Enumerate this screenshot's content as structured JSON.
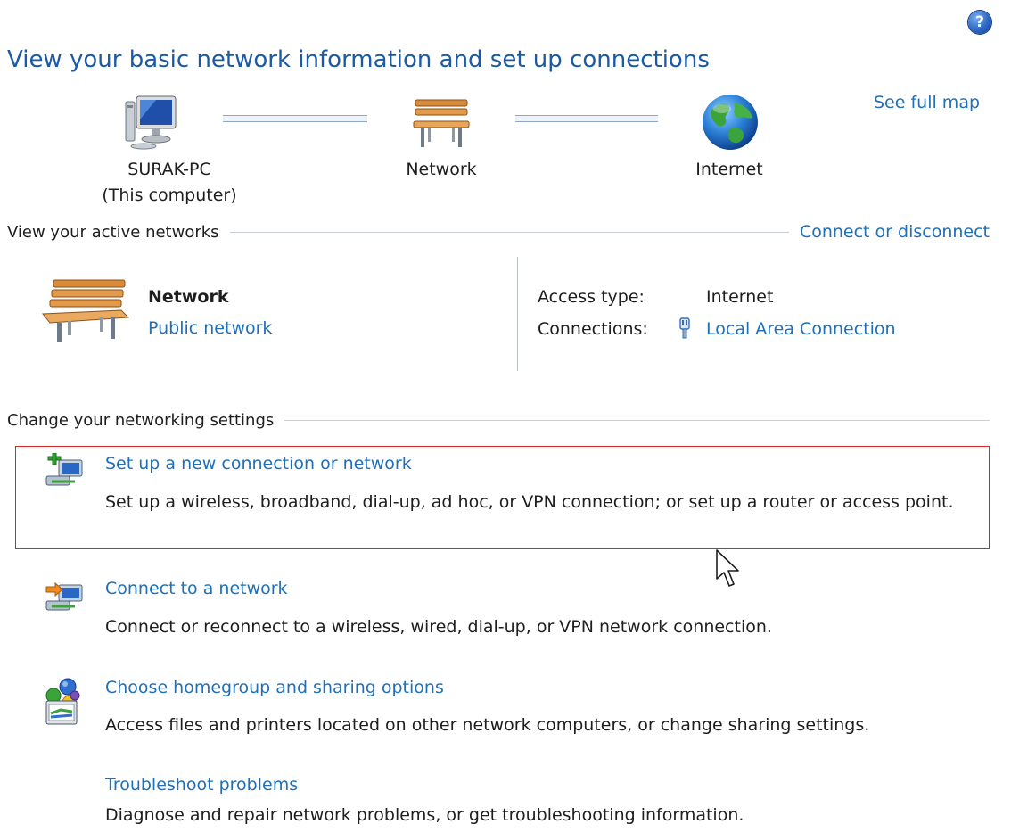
{
  "header": {
    "title": "View your basic network information and set up connections",
    "help_icon": "help-icon",
    "help_glyph": "?"
  },
  "network_map": {
    "computer": {
      "icon": "computer-icon",
      "label_line1": "SURAK-PC",
      "label_line2": "(This computer)"
    },
    "network": {
      "icon": "bench-icon",
      "label": "Network"
    },
    "internet": {
      "icon": "globe-icon",
      "label": "Internet"
    },
    "see_full_map": "See full map"
  },
  "active_networks": {
    "title": "View your active networks",
    "connect_link": "Connect or disconnect",
    "network_name": "Network",
    "network_category": "Public network",
    "access_type_label": "Access type:",
    "access_type_value": "Internet",
    "connections_label": "Connections:",
    "connections_value": "Local Area Connection",
    "connections_icon": "ethernet-plug-icon"
  },
  "settings": {
    "title": "Change your networking settings",
    "tasks": [
      {
        "icon": "new-connection-icon",
        "link": "Set up a new connection or network",
        "description": "Set up a wireless, broadband, dial-up, ad hoc, or VPN connection; or set up a router or access point."
      },
      {
        "icon": "connect-network-icon",
        "link": "Connect to a network",
        "description": "Connect or reconnect to a wireless, wired, dial-up, or VPN network connection."
      },
      {
        "icon": "homegroup-icon",
        "link": "Choose homegroup and sharing options",
        "description": "Access files and printers located on other network computers, or change sharing settings."
      },
      {
        "icon": "troubleshoot-icon",
        "link": "Troubleshoot problems",
        "description": "Diagnose and repair network problems, or get troubleshooting information."
      }
    ]
  },
  "colors": {
    "link": "#1f6fb9",
    "title": "#1b5aa6",
    "highlight_border": "#d8262a"
  }
}
